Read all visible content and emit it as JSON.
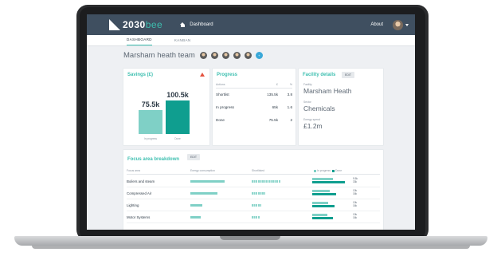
{
  "app": {
    "logo_text": "2030",
    "logo_suffix": "bee",
    "home_label": "Dashboard",
    "about_label": "About"
  },
  "tabs": [
    "DASHBOARD",
    "KANBAN"
  ],
  "team": {
    "title": "Marsham heath team",
    "add_label": "+"
  },
  "savings": {
    "title": "Savings (£)",
    "bars": [
      {
        "label": "75.5k",
        "category": "In progress",
        "value": 75.5
      },
      {
        "label": "100.5k",
        "category": "Done",
        "value": 100.5
      }
    ]
  },
  "progress": {
    "title": "Progress",
    "columns": [
      "Actions",
      "£",
      "%"
    ],
    "rows": [
      {
        "status": "Shortlist",
        "amount": "135.5k",
        "pct": "3.8"
      },
      {
        "status": "In progress",
        "amount": "65k",
        "pct": "1.6"
      },
      {
        "status": "Done",
        "amount": "75.5k",
        "pct": "2"
      }
    ]
  },
  "facility": {
    "title": "Facility details",
    "edit_label": "EDIT",
    "fields": [
      {
        "label": "Facility",
        "value": "Marsham Heath"
      },
      {
        "label": "Sector",
        "value": "Chemicals"
      },
      {
        "label": "Energy spend",
        "value": "£1.2m"
      }
    ]
  },
  "focus": {
    "title": "Focus area breakdown",
    "edit_label": "EDIT",
    "columns": [
      "Focus area",
      "Energy consumption",
      "Shortlisted",
      "In progress",
      "Done"
    ],
    "rows": [
      {
        "name": "Boilers and steam",
        "energy": 0.62,
        "shortlist": 0.75,
        "in_progress": 0.55,
        "done": 0.85,
        "nums": [
          "9.5k",
          "33k"
        ]
      },
      {
        "name": "Compressed Air",
        "energy": 0.48,
        "shortlist": 0.35,
        "in_progress": 0.45,
        "done": 0.62,
        "nums": [
          "10k",
          "16k"
        ]
      },
      {
        "name": "Lighting",
        "energy": 0.22,
        "shortlist": 0.25,
        "in_progress": 0.42,
        "done": 0.58,
        "nums": [
          "10k",
          "16k"
        ]
      },
      {
        "name": "Motor Systems",
        "energy": 0.18,
        "shortlist": 0.2,
        "in_progress": 0.4,
        "done": 0.55,
        "nums": [
          "10k",
          "16k"
        ]
      }
    ]
  },
  "colors": {
    "accent": "#3dbfb0",
    "dark_accent": "#0f9e8f",
    "light_accent": "#7fd0c6",
    "topbar": "#3f4f60",
    "warning": "#e4533f"
  },
  "icons": [
    "home-icon",
    "warning-icon",
    "caret-down-icon"
  ]
}
